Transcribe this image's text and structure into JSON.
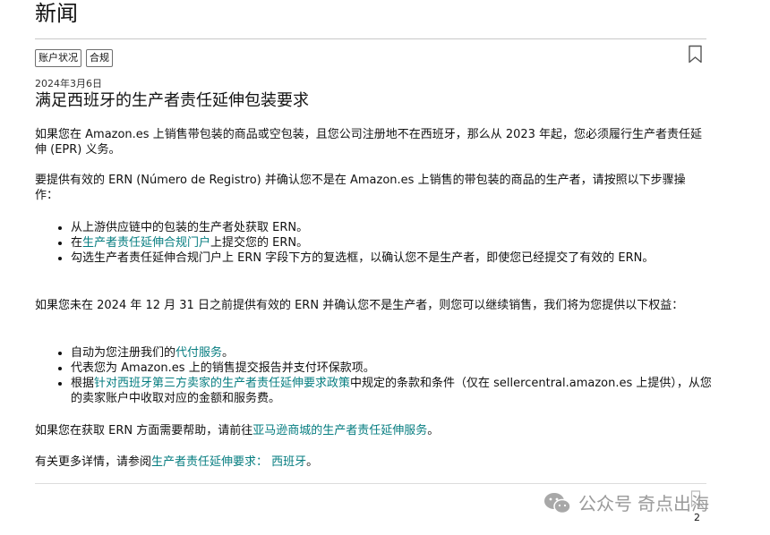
{
  "page": {
    "title": "新闻"
  },
  "tags": [
    "账户状况",
    "合规"
  ],
  "article": {
    "date": "2024年3月6日",
    "headline": "满足西班牙的生产者责任延伸包装要求",
    "p1": "如果您在 Amazon.es 上销售带包装的商品或空包装，且您公司注册地不在西班牙，那么从 2023 年起，您必须履行生产者责任延伸 (EPR) 义务。",
    "p2": "要提供有效的 ERN (Número de Registro) 并确认您不是在 Amazon.es 上销售的带包装的商品的生产者，请按照以下步骤操作：",
    "steps": {
      "s1": "从上游供应链中的包装的生产者处获取 ERN。",
      "s2_prefix": "在",
      "s2_link": "生产者责任延伸合规门户",
      "s2_suffix": "上提交您的 ERN。",
      "s3": "勾选生产者责任延伸合规门户上 ERN 字段下方的复选框，以确认您不是生产者，即使您已经提交了有效的 ERN。"
    },
    "p3": "如果您未在 2024 年 12 月 31 日之前提供有效的 ERN 并确认您不是生产者，则您可以继续销售，我们将为您提供以下权益：",
    "benefits": {
      "b1_prefix": "自动为您注册我们的",
      "b1_link": "代付服务",
      "b1_suffix": "。",
      "b2": "代表您为 Amazon.es 上的销售提交报告并支付环保款项。",
      "b3_prefix": "根据",
      "b3_link": "针对西班牙第三方卖家的生产者责任延伸要求政策",
      "b3_suffix": "中规定的条款和条件（仅在 sellercentral.amazon.es 上提供），从您的卖家账户中收取对应的金额和服务费。"
    },
    "p4_prefix": "如果您在获取 ERN 方面需要帮助，请前往",
    "p4_link": "亚马逊商城的生产者责任延伸服务",
    "p4_suffix": "。",
    "p5_prefix": "有关更多详情，请参阅",
    "p5_link": "生产者责任延伸要求： 西班牙",
    "p5_suffix": "。"
  },
  "watermark": {
    "text1": "公众号",
    "text2": "奇点出海"
  },
  "page_number": "2",
  "colors": {
    "link": "#067d80",
    "rule": "#c8c8c8"
  },
  "icons": {
    "bookmark": "bookmark-icon",
    "wechat": "wechat-icon"
  }
}
